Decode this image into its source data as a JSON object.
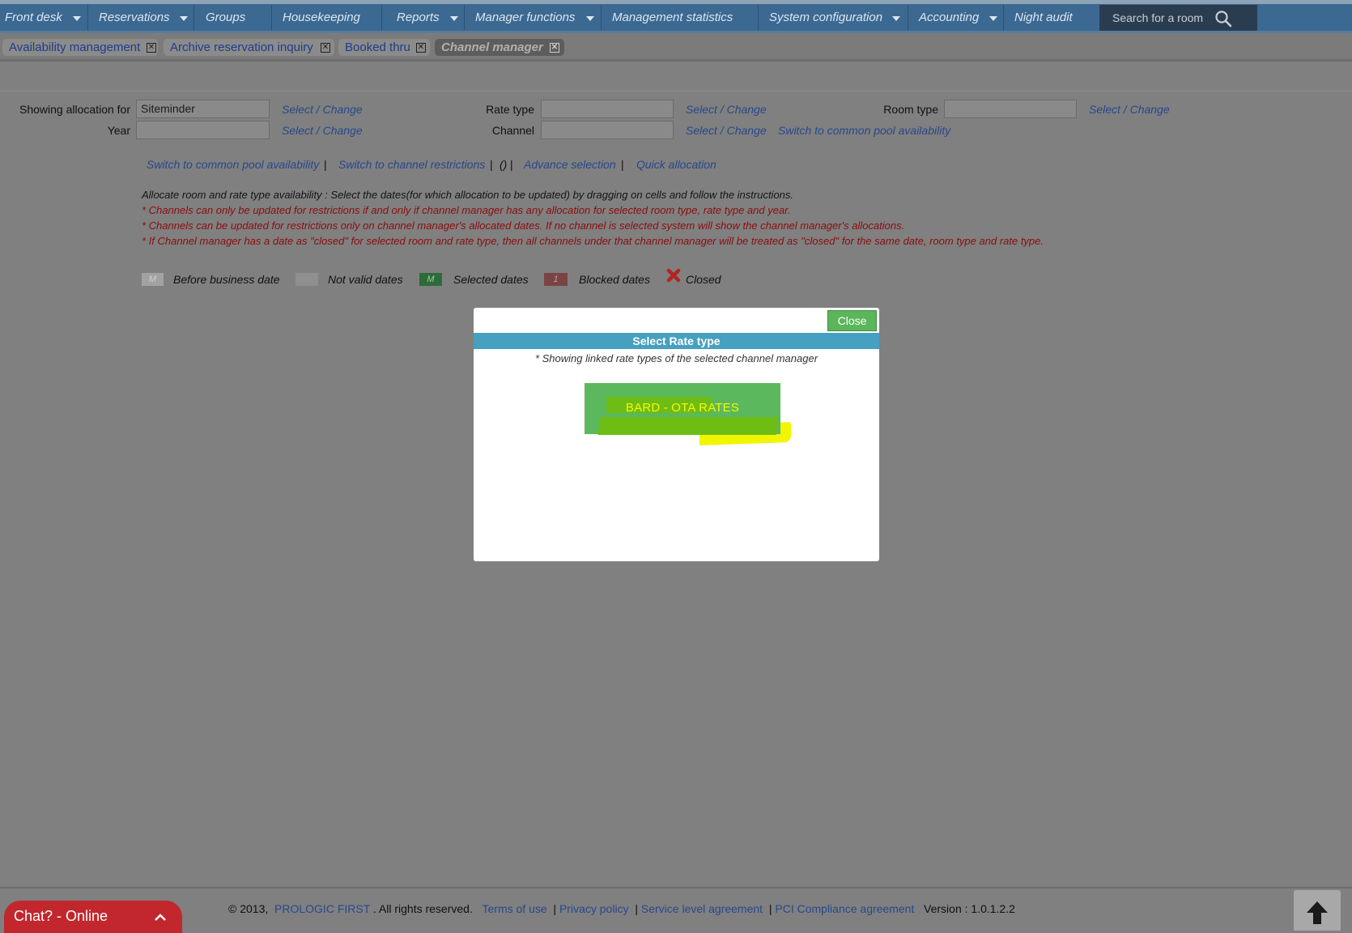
{
  "nav": {
    "items": [
      {
        "label": "Front desk"
      },
      {
        "label": "Reservations"
      },
      {
        "label": "Groups"
      },
      {
        "label": "Housekeeping"
      },
      {
        "label": "Reports"
      },
      {
        "label": "Manager functions"
      },
      {
        "label": "Management statistics"
      },
      {
        "label": "System configuration"
      },
      {
        "label": "Accounting"
      },
      {
        "label": "Night audit"
      }
    ],
    "search_placeholder": "Search for a room"
  },
  "tabs": [
    {
      "label": "Availability management"
    },
    {
      "label": "Archive reservation inquiry"
    },
    {
      "label": "Booked thru"
    },
    {
      "label": "Channel manager"
    }
  ],
  "form": {
    "allocation_label": "Showing allocation for",
    "allocation_value": "Siteminder",
    "year_label": "Year",
    "year_value": "",
    "rate_type_label": "Rate type",
    "rate_type_value": "",
    "channel_label": "Channel",
    "channel_value": "",
    "room_type_label": "Room type",
    "room_type_value": "",
    "select_change": "Select / Change",
    "switch_common_pool": "Switch to common pool availability"
  },
  "links": {
    "switch_common_pool": "Switch to common pool availability",
    "switch_restrictions": "Switch to channel restrictions",
    "empty_parens": "()",
    "advance_selection": "Advance selection",
    "quick_allocation": "Quick allocation"
  },
  "instructions": {
    "main": "Allocate room and rate type availability : Select the dates(for which allocation to be updated) by dragging on cells and follow the instructions.",
    "notes": [
      "* Channels can only be updated for restrictions if and only if channel manager has any allocation for selected room type, rate type and year.",
      "* Channels can be updated for restrictions only on channel manager's allocated dates. If no channel is selected system will show the channel manager's allocations.",
      "* If Channel manager has a date as \"closed\" for selected room and rate type, then all channels under that channel manager will be treated as \"closed\" for the same date, room type and rate type."
    ]
  },
  "legend": {
    "before_box": "M",
    "before_label": "Before business date",
    "invalid_label": "Not valid dates",
    "selected_box": "M",
    "selected_label": "Selected dates",
    "blocked_box": "1",
    "blocked_label": "Blocked dates",
    "closed_label": "Closed"
  },
  "modal": {
    "close_label": "Close",
    "title": "Select Rate type",
    "note": "* Showing linked rate types of the selected channel manager",
    "rate_option": "BARD - OTA RATES"
  },
  "footer": {
    "copyright": "© 2013,",
    "brand": "PROLOGIC FIRST",
    "rights": ". All rights reserved.",
    "terms": "Terms of use",
    "privacy": "Privacy policy",
    "sla": "Service level agreement",
    "pci": "PCI Compliance agreement",
    "version": "Version : 1.0.1.2.2"
  },
  "chat": {
    "label": "Chat? - Online"
  },
  "colors": {
    "nav": "#3c6992",
    "modal_header": "#46a0c0",
    "button_green": "#5cb85c",
    "highlight_yellow": "#f1f500",
    "chat_red": "#c1272d"
  }
}
